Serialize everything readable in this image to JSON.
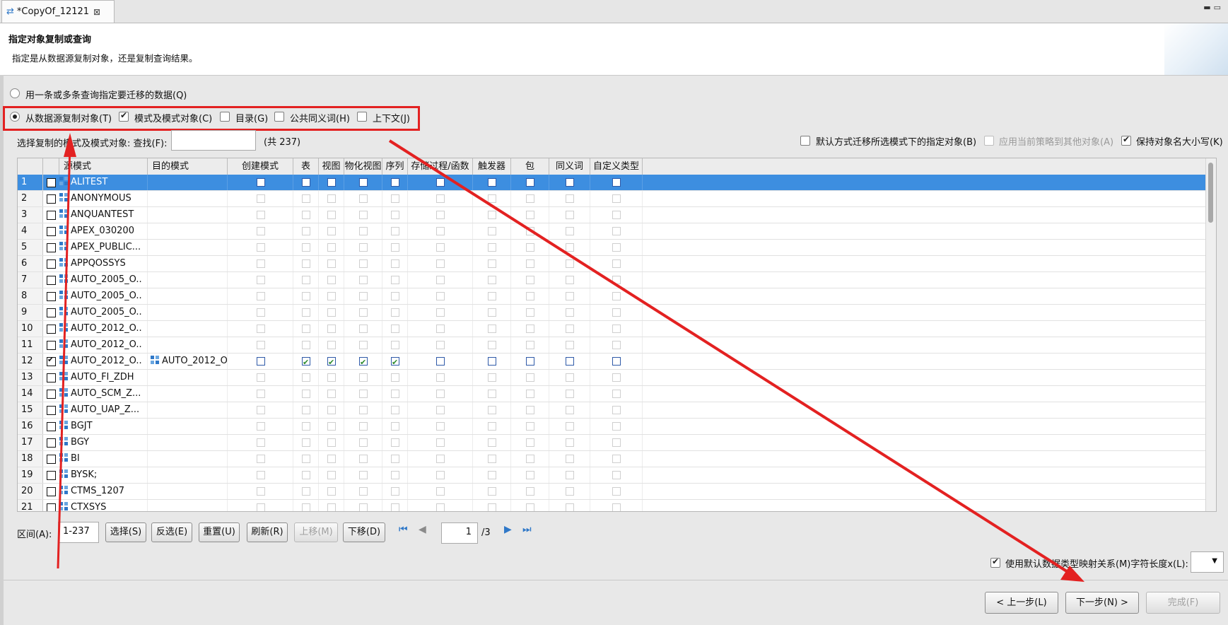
{
  "tab": {
    "title": "*CopyOf_12121",
    "close": "⊠"
  },
  "header": {
    "title": "指定对象复制或查询",
    "subtitle": "指定是从数据源复制对象，还是复制查询结果。"
  },
  "options": {
    "query_label": "用一条或多条查询指定要迁移的数据(Q)",
    "copy_label": "从数据源复制对象(T)",
    "schema_objects": "模式及模式对象(C)",
    "catalog": "目录(G)",
    "public_synonym": "公共同义词(H)",
    "context": "上下文(J)"
  },
  "filter": {
    "label": "选择复制的模式及模式对象: 查找(F):",
    "count": "(共 237)",
    "migrate_default": "默认方式迁移所选模式下的指定对象(B)",
    "apply_policy": "应用当前策略到其他对象(A)",
    "keep_case": "保持对象名大小写(K)"
  },
  "grid": {
    "headers": [
      "",
      "",
      "源模式",
      "目的模式",
      "创建模式",
      "表",
      "视图",
      "物化视图",
      "序列",
      "存储过程/函数",
      "触发器",
      "包",
      "同义词",
      "自定义类型"
    ],
    "rows": [
      {
        "n": "1",
        "src": "ALITEST",
        "dst": "",
        "checked": false,
        "sel": true
      },
      {
        "n": "2",
        "src": "ANONYMOUS",
        "dst": "",
        "checked": false
      },
      {
        "n": "3",
        "src": "ANQUANTEST",
        "dst": "",
        "checked": false
      },
      {
        "n": "4",
        "src": "APEX_030200",
        "dst": "",
        "checked": false
      },
      {
        "n": "5",
        "src": "APEX_PUBLIC...",
        "dst": "",
        "checked": false
      },
      {
        "n": "6",
        "src": "APPQOSSYS",
        "dst": "",
        "checked": false
      },
      {
        "n": "7",
        "src": "AUTO_2005_O..",
        "dst": "",
        "checked": false
      },
      {
        "n": "8",
        "src": "AUTO_2005_O..",
        "dst": "",
        "checked": false
      },
      {
        "n": "9",
        "src": "AUTO_2005_O..",
        "dst": "",
        "checked": false
      },
      {
        "n": "10",
        "src": "AUTO_2012_O..",
        "dst": "",
        "checked": false
      },
      {
        "n": "11",
        "src": "AUTO_2012_O..",
        "dst": "",
        "checked": false
      },
      {
        "n": "12",
        "src": "AUTO_2012_O..",
        "dst": "AUTO_2012_O..",
        "checked": true,
        "opts": [
          false,
          true,
          true,
          true,
          true,
          false,
          false,
          false,
          false,
          false
        ]
      },
      {
        "n": "13",
        "src": "AUTO_FI_ZDH",
        "dst": "",
        "checked": false
      },
      {
        "n": "14",
        "src": "AUTO_SCM_Z...",
        "dst": "",
        "checked": false
      },
      {
        "n": "15",
        "src": "AUTO_UAP_Z...",
        "dst": "",
        "checked": false
      },
      {
        "n": "16",
        "src": "BGJT",
        "dst": "",
        "checked": false
      },
      {
        "n": "17",
        "src": "BGY",
        "dst": "",
        "checked": false
      },
      {
        "n": "18",
        "src": "BI",
        "dst": "",
        "checked": false
      },
      {
        "n": "19",
        "src": "BYSK;",
        "dst": "",
        "checked": false
      },
      {
        "n": "20",
        "src": "CTMS_1207",
        "dst": "",
        "checked": false
      },
      {
        "n": "21",
        "src": "CTXSYS",
        "dst": "",
        "checked": false
      }
    ]
  },
  "bottom": {
    "range_label": "区间(A):",
    "range_value": "1-237",
    "select": "选择(S)",
    "invert": "反选(E)",
    "reset": "重置(U)",
    "refresh": "刷新(R)",
    "move_up": "上移(M)",
    "move_down": "下移(D)",
    "page": "1",
    "pages": "/3",
    "type_mapping": "使用默认数据类型映射关系(M)字符长度x(L):"
  },
  "footer": {
    "back": "< 上一步(L)",
    "next": "下一步(N) >",
    "finish": "完成(F)"
  },
  "colors": {
    "selection": "#3d8ee0",
    "annotation": "#e32121",
    "icon": "#2f78c8"
  }
}
